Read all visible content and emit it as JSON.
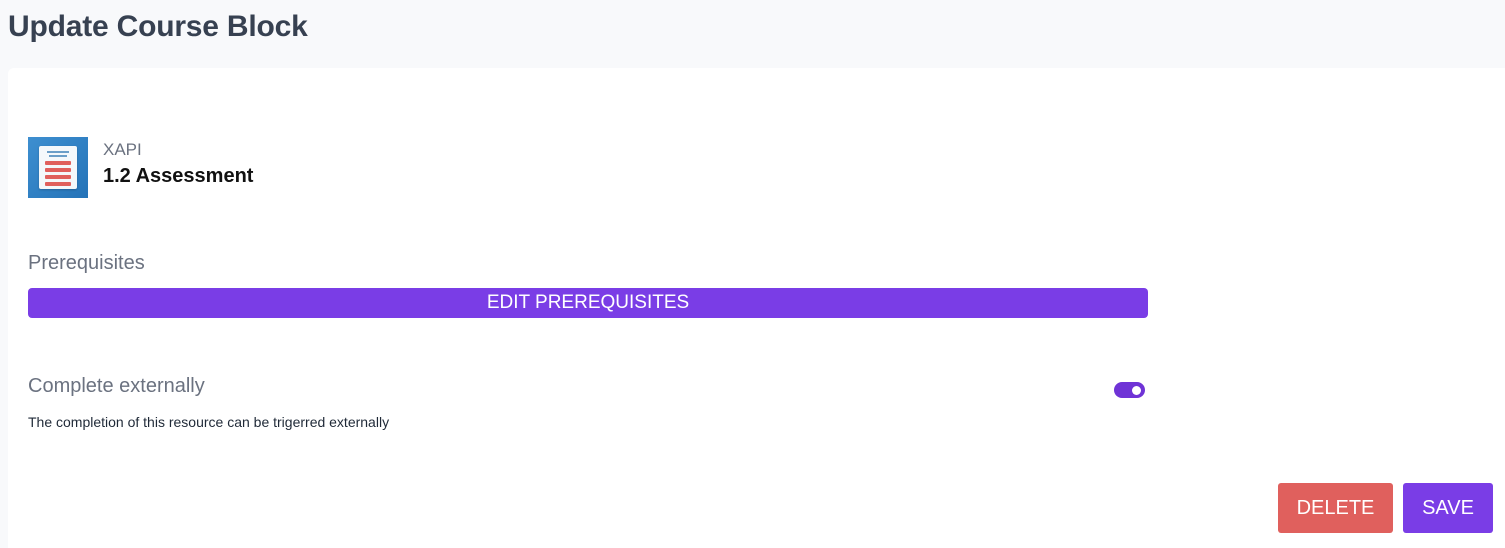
{
  "header": {
    "title": "Update Course Block"
  },
  "resource": {
    "icon": "document-list-icon",
    "type": "XAPI",
    "name": "1.2 Assessment"
  },
  "prerequisites": {
    "label": "Prerequisites",
    "edit_button_label": "EDIT PREREQUISITES"
  },
  "complete_externally": {
    "label": "Complete externally",
    "description": "The completion of this resource can be trigerred externally",
    "enabled": true
  },
  "actions": {
    "delete_label": "DELETE",
    "save_label": "SAVE"
  },
  "colors": {
    "accent": "#7a3de6",
    "danger": "#e0605d",
    "page_background": "#f8f9fb",
    "card_background": "#ffffff"
  }
}
